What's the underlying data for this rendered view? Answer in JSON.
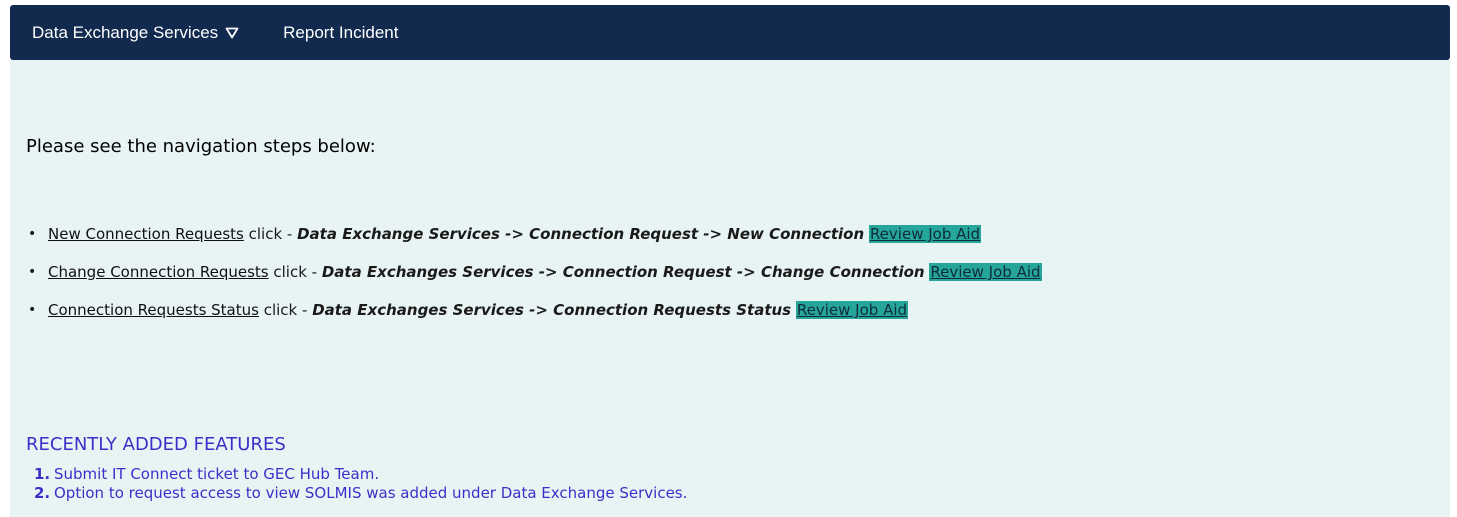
{
  "nav": {
    "items": [
      {
        "label": "Data Exchange Services",
        "has_dropdown": true
      },
      {
        "label": "Report Incident",
        "has_dropdown": false
      }
    ],
    "background": "#112a4e"
  },
  "main": {
    "intro": "Please see the navigation steps below:",
    "steps": [
      {
        "link": "New Connection Requests",
        "middle": " click - ",
        "path": "Data Exchange Services -> Connection Request -> New Connection",
        "job_aid": "Review Job Aid"
      },
      {
        "link": "Change Connection Requests",
        "middle": " click - ",
        "path": "Data Exchanges Services -> Connection Request -> Change Connection",
        "job_aid": "Review Job Aid"
      },
      {
        "link": "Connection Requests Status",
        "middle": " click - ",
        "path": "Data Exchanges Services -> Connection Requests Status",
        "job_aid": "Review Job Aid"
      }
    ]
  },
  "features": {
    "title": "RECENTLY ADDED FEATURES",
    "items": [
      {
        "num": "1.",
        "text": "Submit IT Connect ticket to GEC Hub Team."
      },
      {
        "num": "2.",
        "text": "Option to request access to view SOLMIS was added under Data Exchange Services."
      }
    ],
    "color": "#3b2fc9"
  },
  "colors": {
    "content_background": "#e8f3f3",
    "job_aid_highlight": "#26a69a"
  }
}
